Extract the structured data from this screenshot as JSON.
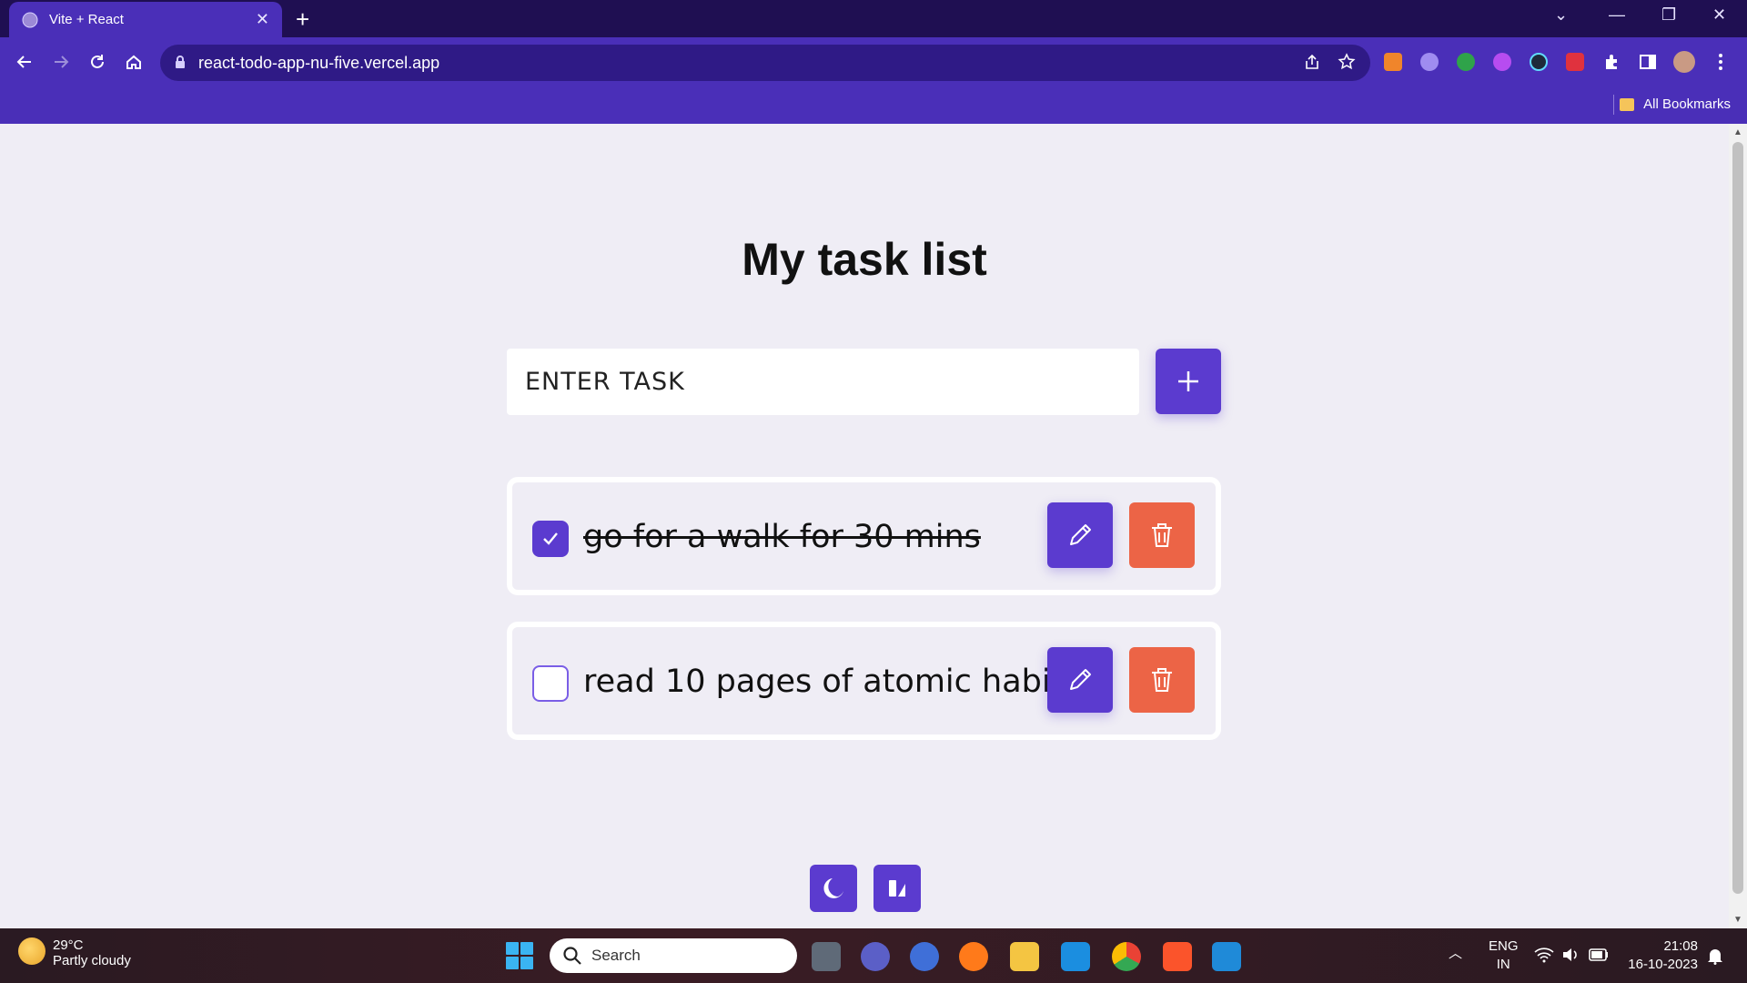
{
  "browser": {
    "tab_title": "Vite + React",
    "url": "react-todo-app-nu-five.vercel.app",
    "bookmarks_label": "All Bookmarks"
  },
  "app": {
    "title": "My task list",
    "input_placeholder": "ENTER TASK",
    "tasks": [
      {
        "text": "go for a walk for 30 mins",
        "completed": true
      },
      {
        "text": "read 10 pages of atomic habits",
        "completed": false
      }
    ],
    "colors": {
      "primary": "#5b3bcf",
      "danger": "#ec6446",
      "background": "#efedf5"
    }
  },
  "taskbar": {
    "temperature": "29°C",
    "weather": "Partly cloudy",
    "search_label": "Search",
    "language": "ENG",
    "region": "IN",
    "time": "21:08",
    "date": "16-10-2023"
  }
}
